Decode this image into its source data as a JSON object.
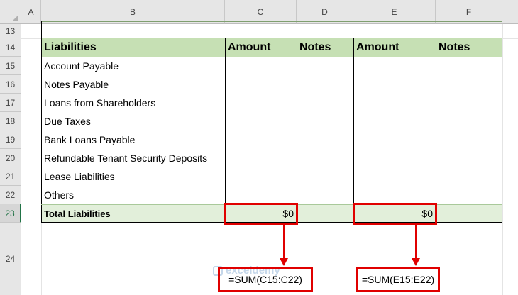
{
  "columns": [
    "A",
    "B",
    "C",
    "D",
    "E",
    "F"
  ],
  "rows": [
    "13",
    "14",
    "15",
    "16",
    "17",
    "18",
    "19",
    "20",
    "21",
    "22",
    "23",
    "24"
  ],
  "active_row": "23",
  "table": {
    "headers": [
      "Liabilities",
      "Amount",
      "Notes",
      "Amount",
      "Notes"
    ],
    "items": [
      "Account Payable",
      "Notes Payable",
      "Loans from Shareholders",
      "Due Taxes",
      "Bank Loans Payable",
      "Refundable Tenant Security Deposits",
      "Lease Liabilities",
      "Others"
    ],
    "total_label": "Total Liabilities",
    "total_c": "$0",
    "total_e": "$0"
  },
  "annotations": {
    "formula_c": "=SUM(C15:C22)",
    "formula_e": "=SUM(E15:E22)",
    "watermark": "exceldemy"
  },
  "colors": {
    "header_fill": "#c6e0b4",
    "total_fill": "#e2efda",
    "highlight": "#e00000"
  }
}
